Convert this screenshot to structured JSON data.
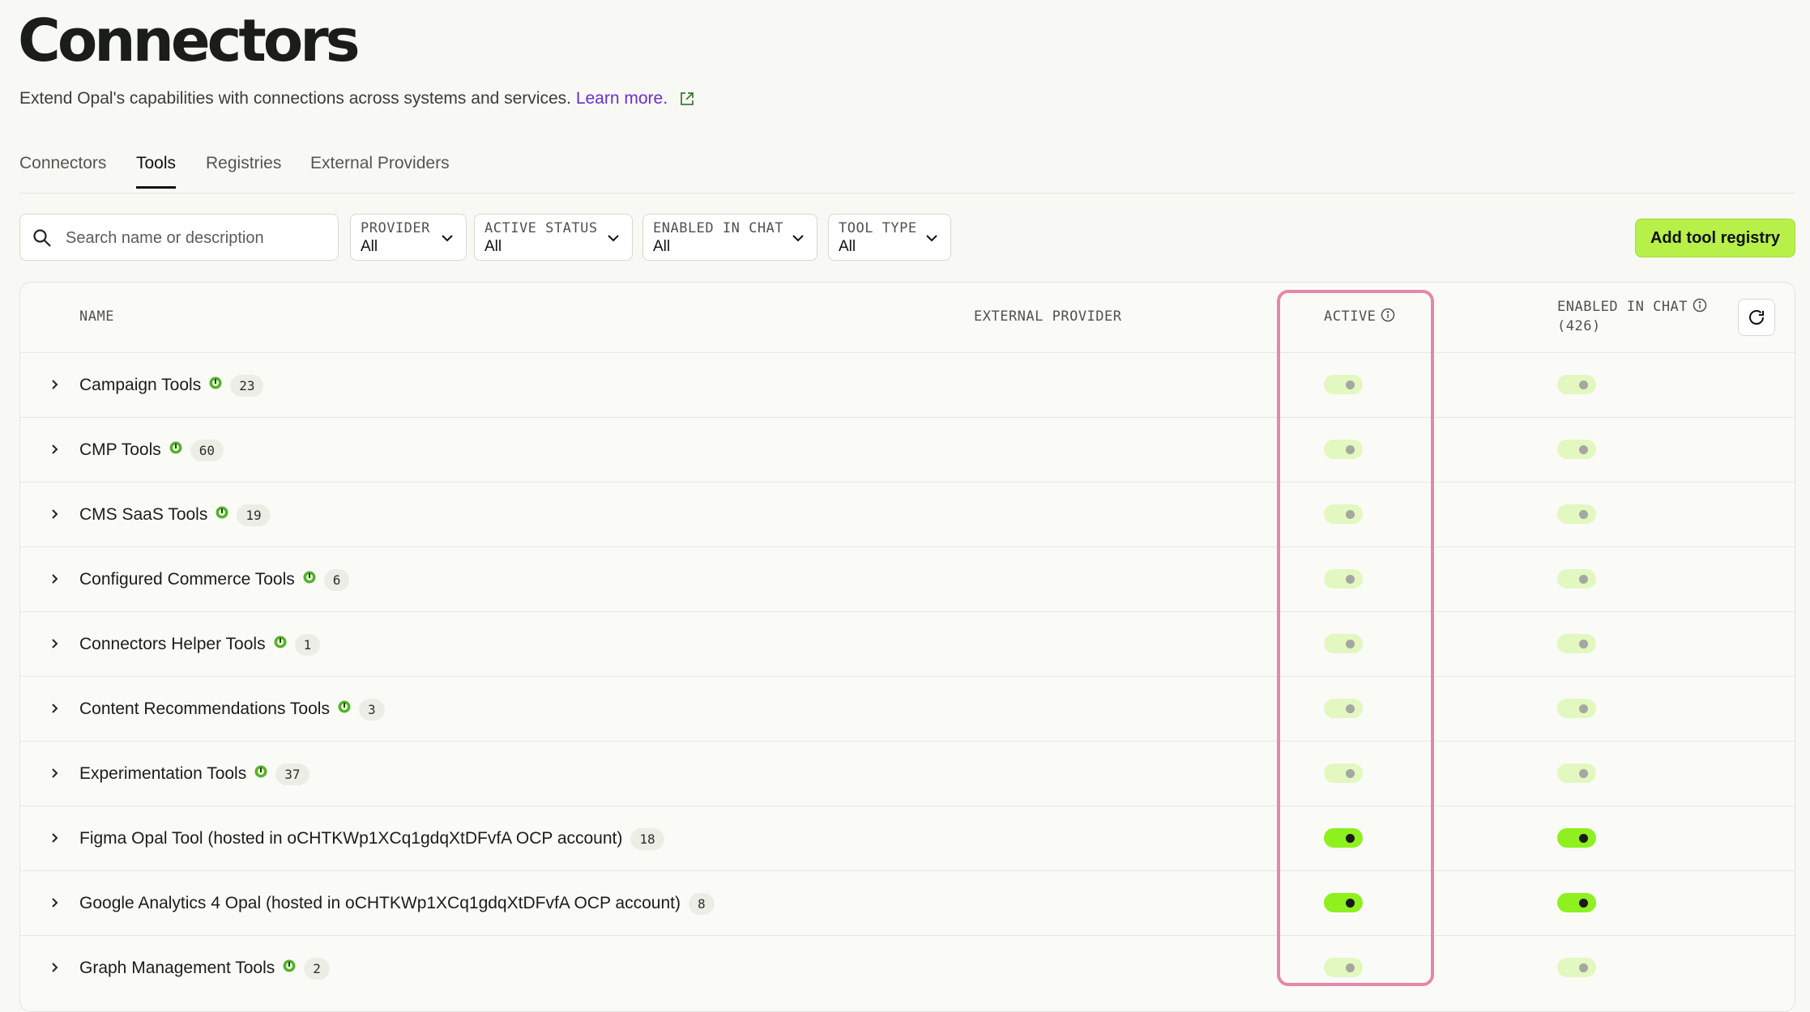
{
  "header": {
    "title": "Connectors",
    "subtitle": "Extend Opal's capabilities with connections across systems and services.",
    "learn_more": "Learn more."
  },
  "tabs": [
    {
      "label": "Connectors",
      "active": false
    },
    {
      "label": "Tools",
      "active": true
    },
    {
      "label": "Registries",
      "active": false
    },
    {
      "label": "External Providers",
      "active": false
    }
  ],
  "filters": {
    "search_placeholder": "Search name or description",
    "provider": {
      "label": "PROVIDER",
      "value": "All"
    },
    "active_status": {
      "label": "ACTIVE STATUS",
      "value": "All"
    },
    "enabled_in_chat": {
      "label": "ENABLED IN CHAT",
      "value": "All"
    },
    "tool_type": {
      "label": "TOOL TYPE",
      "value": "All"
    },
    "add_button": "Add tool registry"
  },
  "table": {
    "columns": {
      "name": "NAME",
      "external_provider": "EXTERNAL PROVIDER",
      "active": "ACTIVE",
      "enabled_in_chat": "ENABLED IN CHAT",
      "enabled_count": "(426)"
    },
    "rows": [
      {
        "name": "Campaign Tools",
        "opal_icon": true,
        "count": "23",
        "active": false,
        "enabled_in_chat": false
      },
      {
        "name": "CMP Tools",
        "opal_icon": true,
        "count": "60",
        "active": false,
        "enabled_in_chat": false
      },
      {
        "name": "CMS SaaS Tools",
        "opal_icon": true,
        "count": "19",
        "active": false,
        "enabled_in_chat": false
      },
      {
        "name": "Configured Commerce Tools",
        "opal_icon": true,
        "count": "6",
        "active": false,
        "enabled_in_chat": false
      },
      {
        "name": "Connectors Helper Tools",
        "opal_icon": true,
        "count": "1",
        "active": false,
        "enabled_in_chat": false
      },
      {
        "name": "Content Recommendations Tools",
        "opal_icon": true,
        "count": "3",
        "active": false,
        "enabled_in_chat": false
      },
      {
        "name": "Experimentation Tools",
        "opal_icon": true,
        "count": "37",
        "active": false,
        "enabled_in_chat": false
      },
      {
        "name": "Figma Opal Tool (hosted in oCHTKWp1XCq1gdqXtDFvfA OCP account)",
        "opal_icon": false,
        "count": "18",
        "active": true,
        "enabled_in_chat": true
      },
      {
        "name": "Google Analytics 4 Opal (hosted in oCHTKWp1XCq1gdqXtDFvfA OCP account)",
        "opal_icon": false,
        "count": "8",
        "active": true,
        "enabled_in_chat": true
      },
      {
        "name": "Graph Management Tools",
        "opal_icon": true,
        "count": "2",
        "active": false,
        "enabled_in_chat": false
      }
    ]
  },
  "colors": {
    "accent": "#b8f04a",
    "toggle_on": "#8ef01f",
    "toggle_off": "#e3f7c0",
    "link": "#6a2fd3",
    "highlight_box": "#e587ab"
  },
  "icons": {
    "search": "search-icon",
    "chevron": "chevron-down-icon",
    "external_link": "external-link-icon",
    "info": "info-icon",
    "refresh": "refresh-icon",
    "expand": "chevron-right-icon",
    "opal": "opal-icon"
  }
}
